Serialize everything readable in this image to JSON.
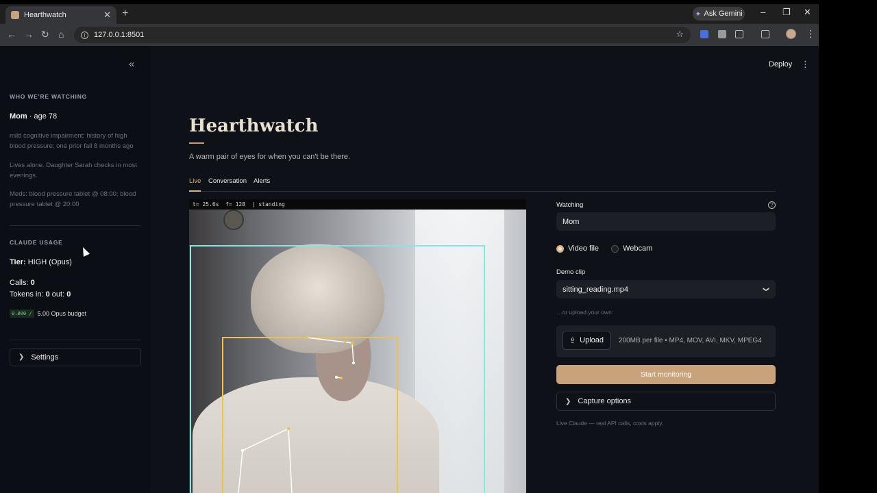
{
  "browser": {
    "tab_title": "Hearthwatch",
    "tab_close": "✕",
    "new_tab": "+",
    "gemini_label": "Ask Gemini",
    "url": "127.0.0.1:8501"
  },
  "sidebar": {
    "watching_heading": "WHO WE'RE WATCHING",
    "person_name": "Mom",
    "person_age": "· age 78",
    "condition": "mild cognitive impairment; history of high blood pressure; one prior fall 8 months ago",
    "living": "Lives alone. Daughter Sarah checks in most evenings.",
    "meds": "Meds: blood pressure tablet @ 08:00; blood pressure tablet @ 20:00",
    "usage_heading": "CLAUDE USAGE",
    "tier_label": "Tier:",
    "tier_value": "HIGH (Opus)",
    "calls_label": "Calls:",
    "calls_value": "0",
    "tokens_label": "Tokens in:",
    "tokens_in": "0",
    "tokens_out_label": "out:",
    "tokens_out": "0",
    "budget_used": "0.000 /",
    "budget_total": "5.00 Opus budget",
    "settings_label": "Settings"
  },
  "header": {
    "deploy": "Deploy"
  },
  "main": {
    "title": "Hearthwatch",
    "subtitle": "A warm pair of eyes for when you can't be there.",
    "tabs": [
      {
        "label": "Live"
      },
      {
        "label": "Conversation"
      },
      {
        "label": "Alerts"
      }
    ],
    "video_hud": "t= 25.6s  f= 128  | standing"
  },
  "controls": {
    "watching_label": "Watching",
    "watching_value": "Mom",
    "source_options": [
      {
        "label": "Video file",
        "selected": true
      },
      {
        "label": "Webcam",
        "selected": false
      }
    ],
    "demo_clip_label": "Demo clip",
    "demo_clip_value": "sitting_reading.mp4",
    "upload_hint_label": "…or upload your own:",
    "upload_button": "Upload",
    "upload_limits": "200MB per file • MP4, MOV, AVI, MKV, MPEG4",
    "start_button": "Start monitoring",
    "capture_options": "Capture options",
    "footer_note": "Live Claude — real API calls, costs apply."
  },
  "colors": {
    "accent": "#c8a27a",
    "background": "#0e1117",
    "sidebar": "#0b0e14",
    "person_box": "#7fe8e0",
    "pose_box": "#e8c44a"
  }
}
